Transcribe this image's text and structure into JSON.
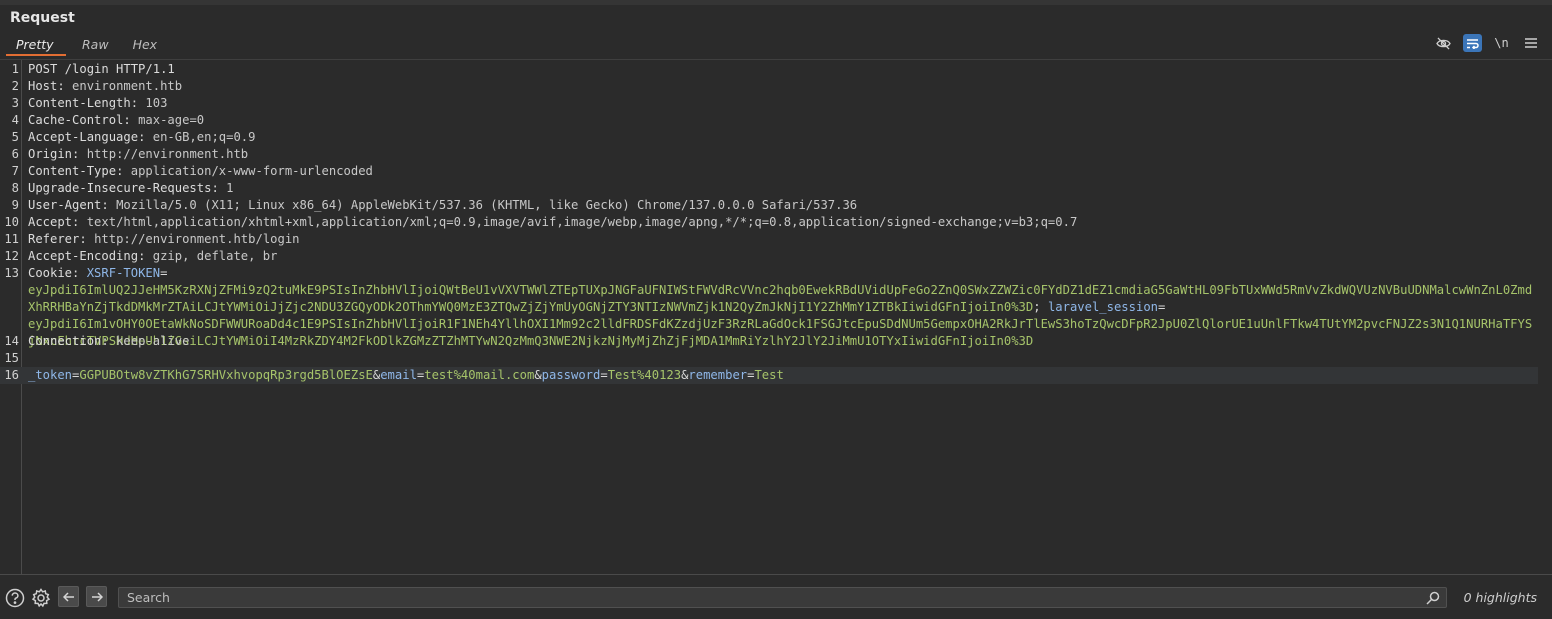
{
  "panel": {
    "title": "Request"
  },
  "tabs": [
    {
      "label": "Pretty",
      "active": true
    },
    {
      "label": "Raw",
      "active": false
    },
    {
      "label": "Hex",
      "active": false
    }
  ],
  "toolbar": {
    "icons": [
      "eye-slash-icon",
      "word-wrap-icon",
      "newline-toggle-icon",
      "menu-icon"
    ],
    "newline_label": "\\n"
  },
  "request": {
    "request_line": "POST /login HTTP/1.1",
    "headers": [
      {
        "name": "Host",
        "value": "environment.htb"
      },
      {
        "name": "Content-Length",
        "value": "103"
      },
      {
        "name": "Cache-Control",
        "value": "max-age=0"
      },
      {
        "name": "Accept-Language",
        "value": "en-GB,en;q=0.9"
      },
      {
        "name": "Origin",
        "value": "http://environment.htb"
      },
      {
        "name": "Content-Type",
        "value": "application/x-www-form-urlencoded"
      },
      {
        "name": "Upgrade-Insecure-Requests",
        "value": "1"
      },
      {
        "name": "User-Agent",
        "value": "Mozilla/5.0 (X11; Linux x86_64) AppleWebKit/537.36 (KHTML, like Gecko) Chrome/137.0.0.0 Safari/537.36"
      },
      {
        "name": "Accept",
        "value": "text/html,application/xhtml+xml,application/xml;q=0.9,image/avif,image/webp,image/apng,*/*;q=0.8,application/signed-exchange;v=b3;q=0.7"
      },
      {
        "name": "Referer",
        "value": "http://environment.htb/login"
      },
      {
        "name": "Accept-Encoding",
        "value": "gzip, deflate, br"
      }
    ],
    "cookie": {
      "name": "Cookie",
      "xsrf_name": "XSRF-TOKEN",
      "xsrf_value": "eyJpdiI6ImlUQ2JJeHM5KzRXNjZFMi9zQ2tuMkE9PSIsInZhbHVlIjoiQWtBeU1vVXVTWWlZTEpTUXpJNGFaUFNIWStFWVdRcVVnc2hqb0EwekRBdUVidUpFeGo2ZnQ0SWxZZWZic0FYdDZ1dEZ1cmdiaG5GaWtHL09FbTUxWWd5RmVvZkdWQVUzNVBuUDNMalcwWnZnL0ZmdXhRRHBaYnZjTkdDMkMrZTAiLCJtYWMiOiJjZjc2NDU3ZGQyODk2OThmYWQ0MzE3ZTQwZjZjYmUyOGNjZTY3NTIzNWVmZjk1N2QyZmJkNjI1Y2ZhMmY1ZTBkIiwidGFnIjoiIn0%3D",
      "session_name": "laravel_session",
      "session_value": "eyJpdiI6Im1vOHY0OEtaWkNoSDFWWURoaDd4c1E9PSIsInZhbHVlIjoiR1F1NEh4YllhOXI1Mm92c2lldFRDSFdKZzdjUzF3RzRLaGdOck1FSGJtcEpuSDdNUm5GempxOHA2RkJrTlEwS3hoTzQwcDFpR2JpU0ZlQlorUE1uUnlFTkw4TUtYM2pvcFNJZ2s3N1Q1NURHaTFYSjNxcEhrcTVPSHdHeUh1ZGsiLCJtYWMiOiI4MzRkZDY4M2FkODlkZGMzZTZhMTYwN2QzMmQ3NWE2NjkzNjMyMjZhZjFjMDA1MmRiYzlhY2JlY2JiMmU1OTYxIiwidGFnIjoiIn0%3D"
    },
    "connection": {
      "name": "Connection",
      "value": "keep-alive"
    },
    "body": [
      {
        "key": "_token",
        "value": "GGPUBOtw8vZTKhG7SRHVxhvopqRp3rgd5BlOEZsE"
      },
      {
        "key": "email",
        "value": "test%40mail.com"
      },
      {
        "key": "password",
        "value": "Test%40123"
      },
      {
        "key": "remember",
        "value": "Test"
      }
    ]
  },
  "line_numbers": [
    "1",
    "2",
    "3",
    "4",
    "5",
    "6",
    "7",
    "8",
    "9",
    "10",
    "11",
    "12",
    "13",
    "14",
    "15",
    "16"
  ],
  "search": {
    "placeholder": "Search",
    "value": ""
  },
  "status": {
    "highlights": "0 highlights"
  },
  "colors": {
    "accent_tab": "#e36e33",
    "toggle_on": "#3b75b8",
    "cookie_name": "#8fb7e8",
    "cookie_value": "#a6c46a"
  }
}
